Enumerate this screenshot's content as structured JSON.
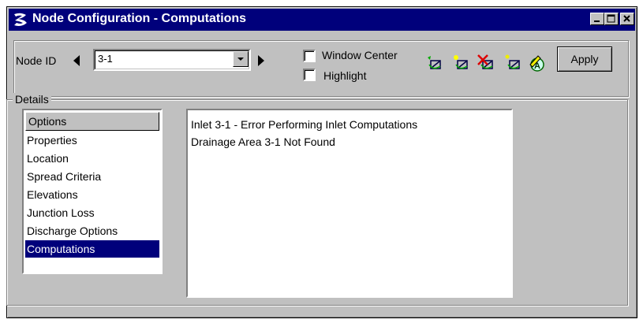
{
  "window": {
    "title": "Node Configuration - Computations"
  },
  "toolbar": {
    "node_id_label": "Node ID",
    "node_id_value": "3-1",
    "window_center_label": "Window Center",
    "highlight_label": "Highlight",
    "window_center_checked": false,
    "highlight_checked": false,
    "apply_label": "Apply",
    "icons": [
      "add-node-icon",
      "new-node-icon",
      "delete-node-icon",
      "copy-node-icon",
      "edit-node-icon"
    ]
  },
  "details": {
    "legend": "Details",
    "options_header": "Options",
    "options": [
      "Properties",
      "Location",
      "Spread Criteria",
      "Elevations",
      "Junction Loss",
      "Discharge Options",
      "Computations"
    ],
    "selected_option": "Computations",
    "messages": [
      "Inlet 3-1 - Error Performing Inlet Computations",
      "Drainage Area 3-1 Not Found"
    ]
  },
  "colors": {
    "titlebar": "#00007b",
    "face": "#c0c0c0",
    "selection": "#00007b"
  }
}
